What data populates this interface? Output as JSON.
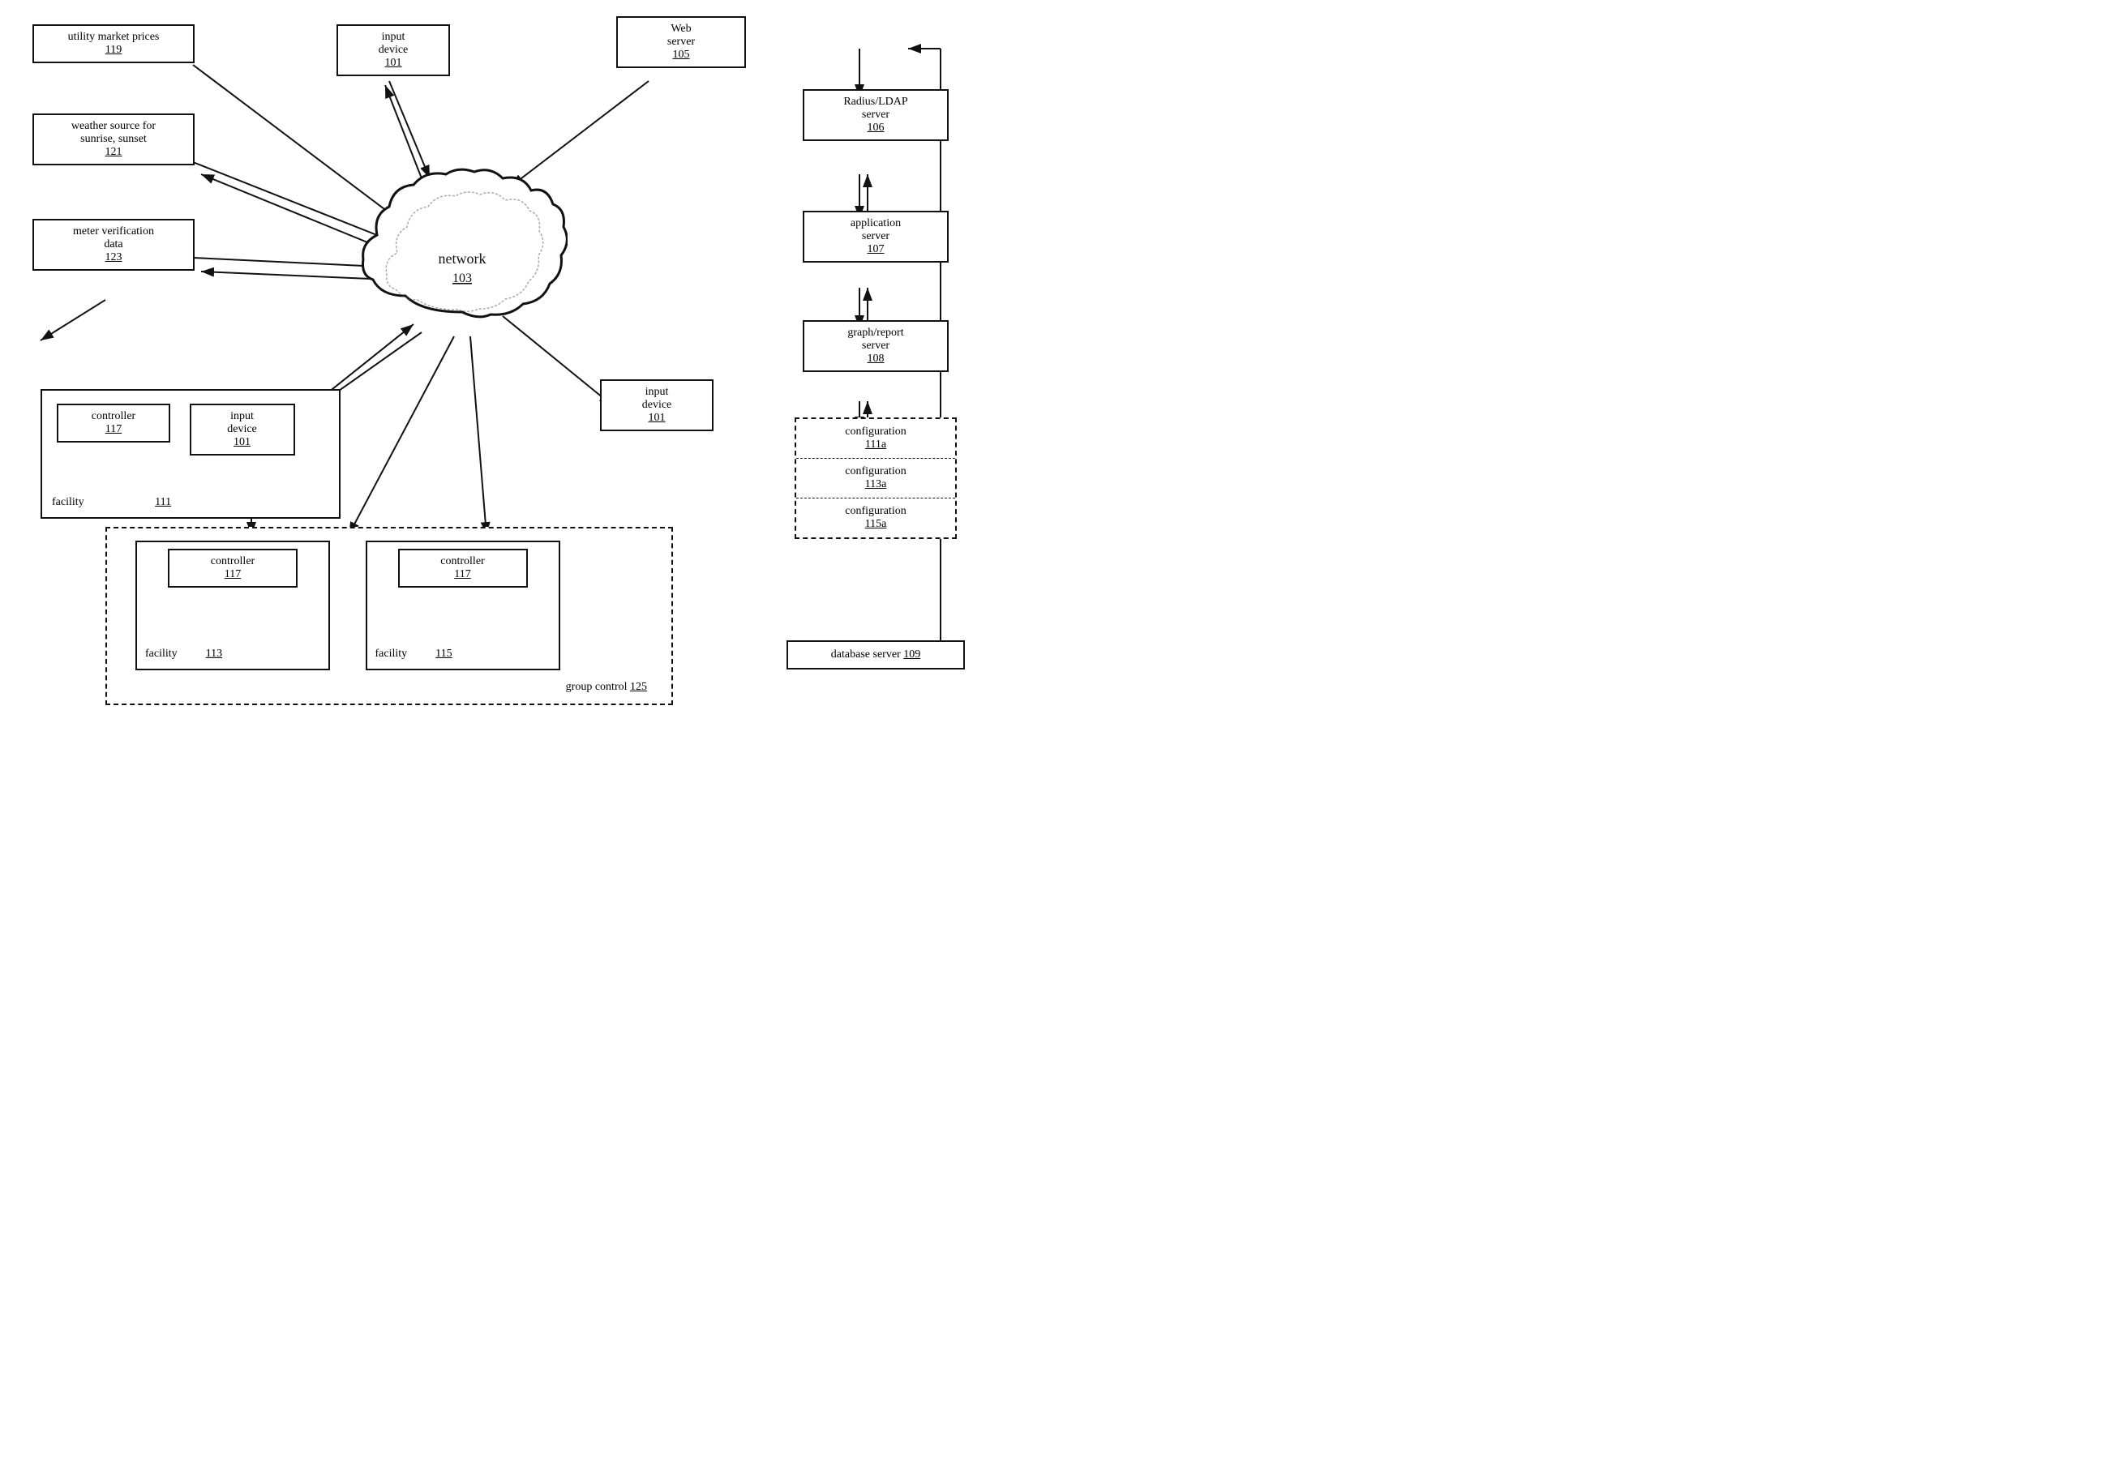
{
  "boxes": {
    "utility_market": {
      "label": "utility market prices",
      "ref": "119"
    },
    "weather_source": {
      "label": "weather source for\nsunrise, sunset",
      "ref": "121"
    },
    "meter_verification": {
      "label": "meter verification\ndata",
      "ref": "123"
    },
    "input_device_top": {
      "label": "input\ndevice",
      "ref": "101"
    },
    "web_server": {
      "label": "Web\nserver",
      "ref": "105"
    },
    "radius_ldap": {
      "label": "Radius/LDAP\nserver",
      "ref": "106"
    },
    "application_server": {
      "label": "application\nserver",
      "ref": "107"
    },
    "graph_report": {
      "label": "graph/report\nserver",
      "ref": "108"
    },
    "config_111a": {
      "label": "configuration",
      "ref": "111a"
    },
    "config_113a": {
      "label": "configuration",
      "ref": "113a"
    },
    "config_115a": {
      "label": "configuration",
      "ref": "115a"
    },
    "database_server": {
      "label": "database server",
      "ref": "109"
    },
    "facility_111": {
      "label": "facility",
      "ref": "111",
      "controller_ref": "117",
      "input_ref": "101",
      "input_label": "input\ndevice"
    },
    "input_device_right": {
      "label": "input\ndevice",
      "ref": "101"
    },
    "network": {
      "label": "network",
      "ref": "103"
    },
    "group_control": {
      "label": "group control",
      "ref": "125"
    },
    "facility_113": {
      "label": "facility",
      "ref": "113",
      "controller_ref": "117"
    },
    "facility_115": {
      "label": "facility",
      "ref": "115",
      "controller_ref": "117"
    }
  }
}
